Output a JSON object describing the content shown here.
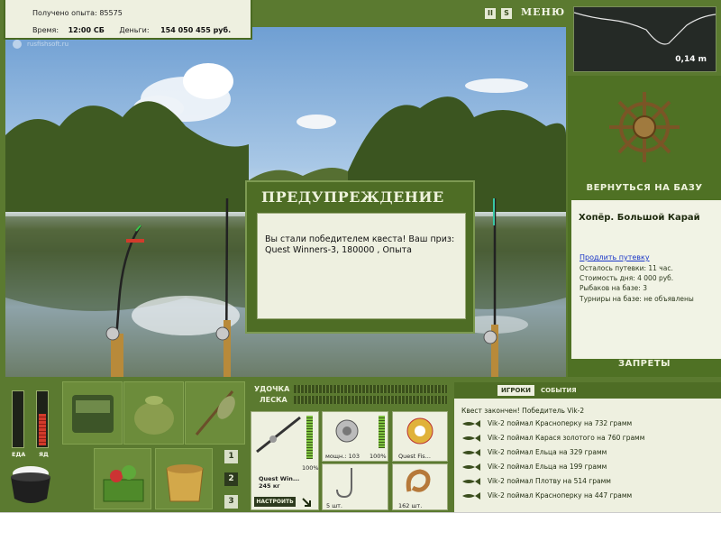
{
  "stats": {
    "xp_label": "Получено опыта:",
    "xp_value": "85575",
    "time_label": "Время:",
    "time_value": "12:00 СБ",
    "money_label": "Деньги:",
    "money_value": "154 050 455 руб."
  },
  "watermark": "rusfishsoft.ru",
  "top_controls": {
    "pause": "II",
    "sound": "S",
    "menu": "МЕНЮ"
  },
  "depth": {
    "value": "0,14 m"
  },
  "location": {
    "return_label": "ВЕРНУТЬСЯ НА БАЗУ",
    "name": "Хопёр. Большой Карай",
    "extend_link": "Продлить путевку",
    "lines": [
      "Осталось путевки: 11 час.",
      "Стоимость дня: 4 000 руб.",
      "Рыбаков на базе: 3",
      "Турниры на базе: не объявлены"
    ],
    "bans_label": "ЗАПРЕТЫ"
  },
  "dialog": {
    "title": "ПРЕДУПРЕЖДЕНИЕ",
    "message": "Вы стали победителем квеста! Ваш приз: Quest Winners-3, 180000 , Опыта"
  },
  "needs": {
    "food_label": "ЕДА",
    "poison_label": "ЯД",
    "food_level": 0.0,
    "poison_level": 0.6
  },
  "pages": [
    "1",
    "2",
    "3"
  ],
  "active_page": "2",
  "tackle": {
    "rod_label": "УДОЧКА",
    "line_label": "ЛЕСКА",
    "rod_name": "Quest Win...",
    "rod_weight": "245 кг",
    "rod_percent": "100%",
    "reel_caption": "мощн.: 103",
    "reel_percent": "100%",
    "line_caption": "Quest Fis...",
    "hook_caption": "5 шт.",
    "bait_caption": "162 шт.",
    "setup_label": "НАСТРОИТЬ"
  },
  "log": {
    "tabs": [
      "ИГРОКИ",
      "СОБЫТИЯ"
    ],
    "header": "Квест закончен! Победитель Vik-2",
    "entries": [
      "Vik-2 поймал Красноперку на 732 грамм",
      "Vik-2 поймал Карася золотого на 760 грамм",
      "Vik-2 поймал Ельца на 329 грамм",
      "Vik-2 поймал Ельца на 199 грамм",
      "Vik-2 поймал Плотву на 514 грамм",
      "Vik-2 поймал Красноперку на 447 грамм"
    ]
  },
  "colors": {
    "frame": "#5b7a30",
    "panel": "#eef0e0",
    "accent_red": "#d23b2b"
  },
  "icons": [
    "home-icon",
    "pause-icon",
    "sound-icon",
    "ship-wheel-icon",
    "backpack-icon",
    "bait-bag-icon",
    "tools-icon",
    "vegetable-basket-icon",
    "wooden-bucket-icon",
    "cauldron-icon",
    "fishing-rod-icon",
    "reel-icon",
    "line-spool-icon",
    "hook-icon",
    "bait-icon",
    "fish-icon"
  ]
}
